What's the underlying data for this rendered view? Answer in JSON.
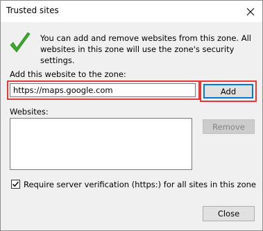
{
  "window": {
    "title": "Trusted sites"
  },
  "info": {
    "text": "You can add and remove websites from this zone. All websites in this zone will use the zone's security settings."
  },
  "add_section": {
    "label": "Add this website to the zone:",
    "input_value": "https://maps.google.com",
    "add_label": "Add"
  },
  "websites": {
    "label": "Websites:",
    "items": [],
    "remove_label": "Remove"
  },
  "verification": {
    "label": "Require server verification (https:) for all sites in this zone",
    "checked": true
  },
  "footer": {
    "close_label": "Close"
  },
  "icons": {
    "close": "close-icon",
    "check": "check-icon"
  },
  "colors": {
    "highlight": "#e53935",
    "accent": "#0078d7",
    "check_green": "#3aa82e"
  }
}
